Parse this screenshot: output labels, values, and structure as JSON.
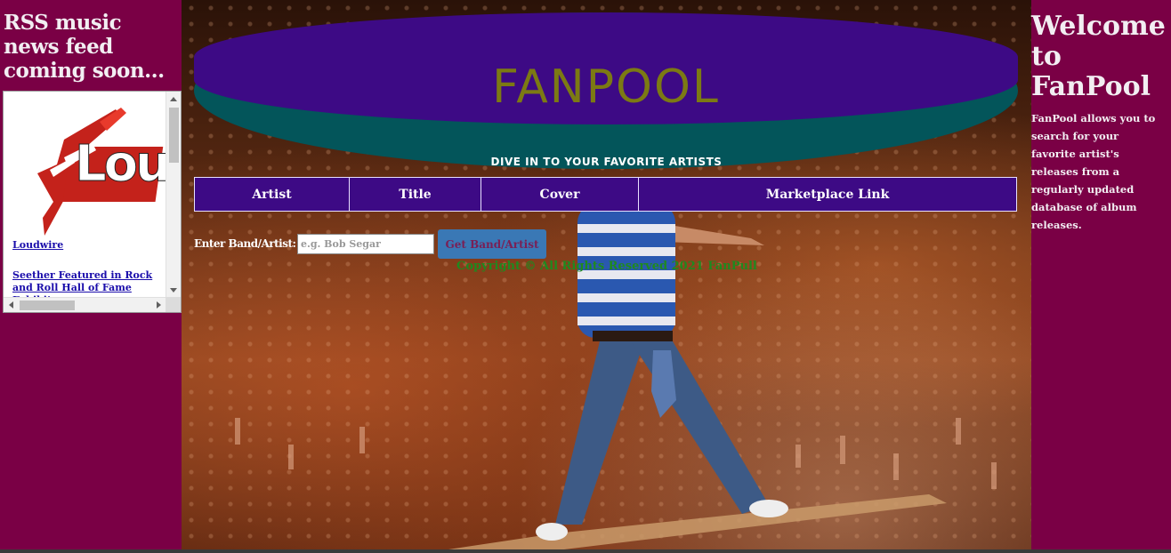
{
  "left": {
    "title": "RSS music news feed coming soon...",
    "feed": {
      "logo_text": "Lou",
      "links": [
        "Loudwire",
        "Seether Featured in Rock and Roll Hall of Fame Exhibit"
      ]
    }
  },
  "header": {
    "logo": "FANPOOL",
    "tagline": "DIVE IN TO YOUR FAVORITE ARTISTS"
  },
  "table": {
    "columns": [
      "Artist",
      "Title",
      "Cover",
      "Marketplace Link"
    ]
  },
  "search": {
    "label": "Enter Band/Artist:",
    "placeholder": "e.g. Bob Segar",
    "button_label": "Get Band/Artist"
  },
  "footer": {
    "copyright": "Copyright © All Rights Reserved 2021 FanPull"
  },
  "right": {
    "title": "Welcome to FanPool",
    "description": "FanPool allows you to search for your favorite artist's releases from a regularly updated database of album releases."
  },
  "colors": {
    "sidebar_bg": "#7a0045",
    "header_purple": "#3d0a85",
    "header_teal": "#03555a",
    "logo_olive": "#7c7a13",
    "button_blue": "#3a78b5",
    "copyright_green": "#1f8a1f"
  },
  "icons": [
    "guitar-logo-icon",
    "scroll-up-icon",
    "scroll-down-icon",
    "scroll-left-icon",
    "scroll-right-icon"
  ]
}
